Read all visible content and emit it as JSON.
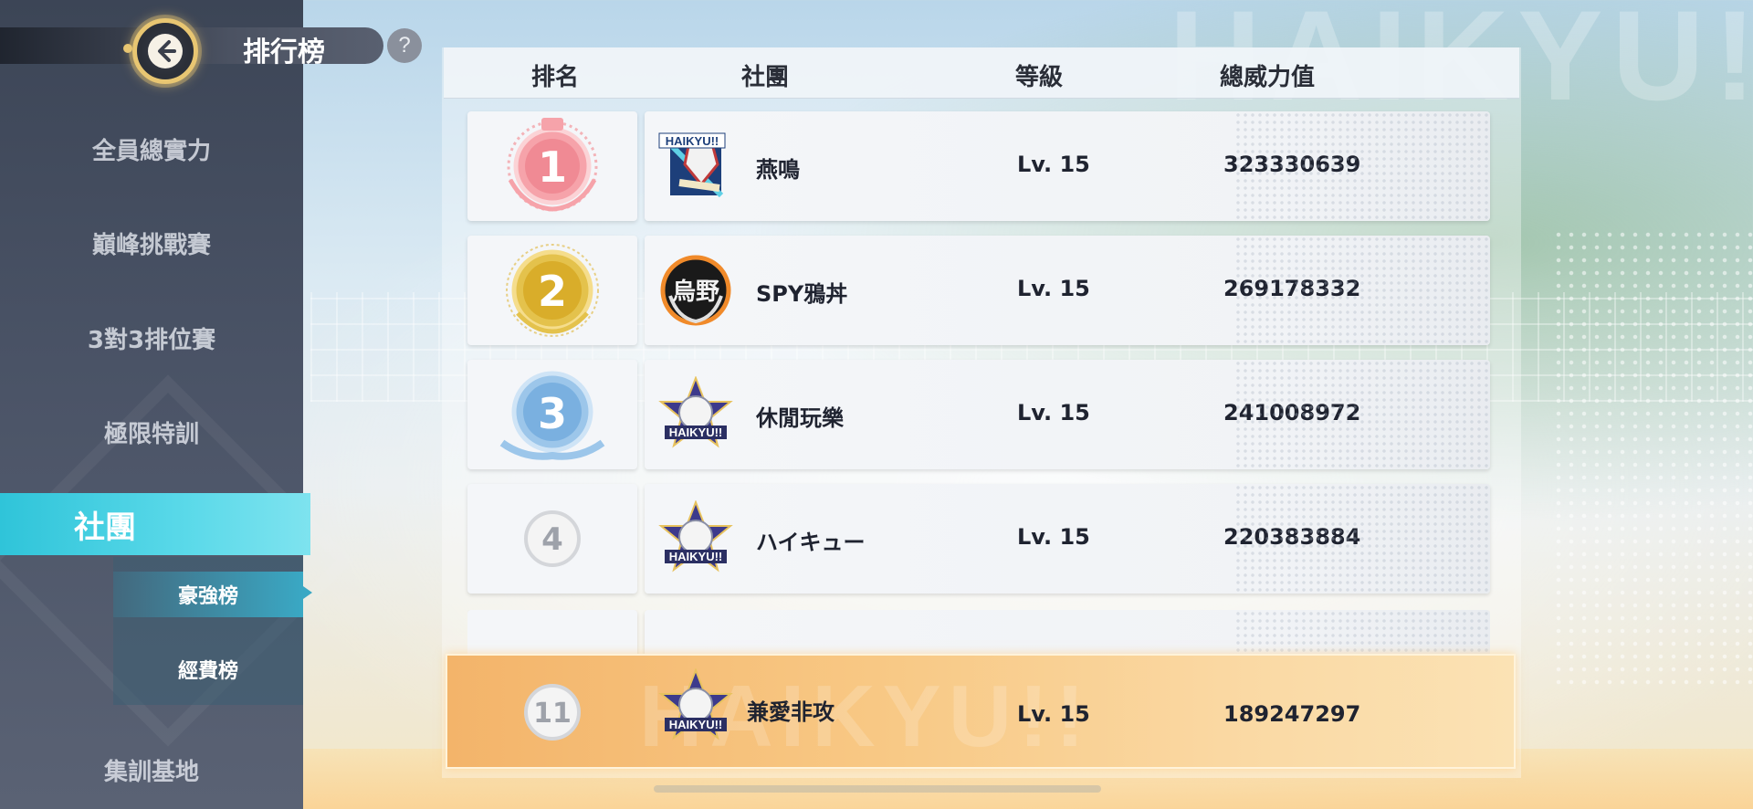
{
  "header": {
    "title": "排行榜",
    "help": "?"
  },
  "sidebar": {
    "items": [
      {
        "label": "全員總實力"
      },
      {
        "label": "巔峰挑戰賽"
      },
      {
        "label": "3對3排位賽"
      },
      {
        "label": "極限特訓"
      },
      {
        "label": "社團"
      },
      {
        "label": "集訓基地"
      }
    ],
    "sub_items": [
      {
        "label": "豪強榜"
      },
      {
        "label": "經費榜"
      }
    ]
  },
  "table": {
    "columns": [
      "排名",
      "社團",
      "等級",
      "總威力值"
    ],
    "rows": [
      {
        "rank": "1",
        "club": "燕鳴",
        "level": "Lv. 15",
        "power": "323330639"
      },
      {
        "rank": "2",
        "club": "SPY鴉丼",
        "level": "Lv. 15",
        "power": "269178332"
      },
      {
        "rank": "3",
        "club": "休閒玩樂",
        "level": "Lv. 15",
        "power": "241008972"
      },
      {
        "rank": "4",
        "club": "ハイキュー",
        "level": "Lv. 15",
        "power": "220383884"
      }
    ],
    "my_row": {
      "rank": "11",
      "club": "兼愛非攻",
      "level": "Lv. 15",
      "power": "189247297"
    }
  },
  "background": {
    "text": "HAIKYU!!"
  },
  "emblem_text": {
    "haikyu": "HAIKYU!!",
    "karasuno": "烏野"
  },
  "colors": {
    "accent": "#2fc4d9",
    "gold": "#e8c672",
    "my_row": "#f8c884"
  }
}
